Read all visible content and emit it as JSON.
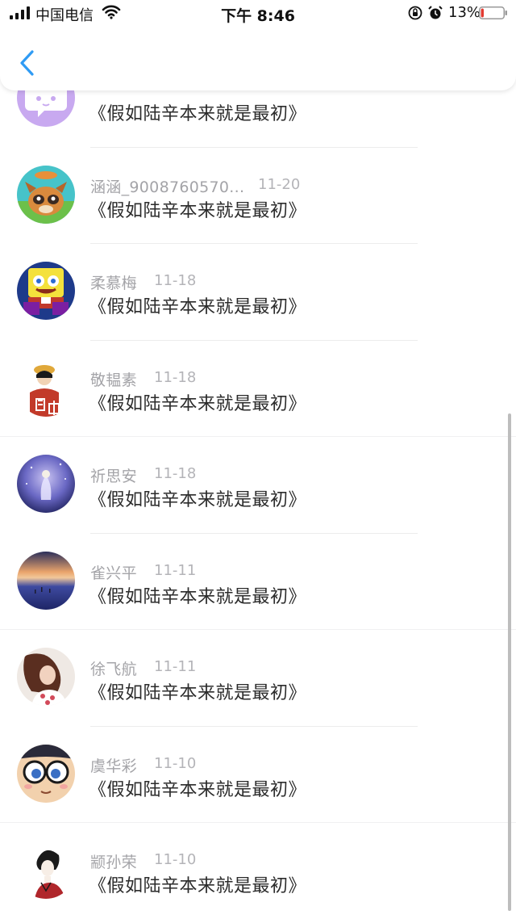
{
  "status_bar": {
    "carrier": "中国电信",
    "time": "下午 8:46",
    "battery_percent": "13%",
    "battery_level": 0.13,
    "battery_color": "#e23b32"
  },
  "header": {
    "back_icon": "chevron-left-icon",
    "accent_color": "#2f9bf4"
  },
  "comments": [
    {
      "name": "",
      "date": "",
      "text": "《假如陆辛本来就是最初》",
      "avatar": "default-purple-chat-avatar"
    },
    {
      "name": "涵涵_9008760570...",
      "date": "11-20",
      "text": "《假如陆辛本来就是最初》",
      "avatar": "raccoon-avatar"
    },
    {
      "name": "柔慕梅",
      "date": "11-18",
      "text": "《假如陆辛本来就是最初》",
      "avatar": "cartoon-sponge-avatar"
    },
    {
      "name": "敬韫素",
      "date": "11-18",
      "text": "《假如陆辛本来就是最初》",
      "avatar": "anime-boy-avatar"
    },
    {
      "name": "祈思安",
      "date": "11-18",
      "text": "《假如陆辛本来就是最初》",
      "avatar": "starry-girl-avatar"
    },
    {
      "name": "雀兴平",
      "date": "11-11",
      "text": "《假如陆辛本来就是最初》",
      "avatar": "sunset-lake-avatar"
    },
    {
      "name": "徐飞航",
      "date": "11-11",
      "text": "《假如陆辛本来就是最初》",
      "avatar": "woman-portrait-avatar"
    },
    {
      "name": "虞华彩",
      "date": "11-10",
      "text": "《假如陆辛本来就是最初》",
      "avatar": "anime-glasses-avatar"
    },
    {
      "name": "颛孙荣",
      "date": "11-10",
      "text": "《假如陆辛本来就是最初》",
      "avatar": "sketch-boy-avatar"
    }
  ]
}
